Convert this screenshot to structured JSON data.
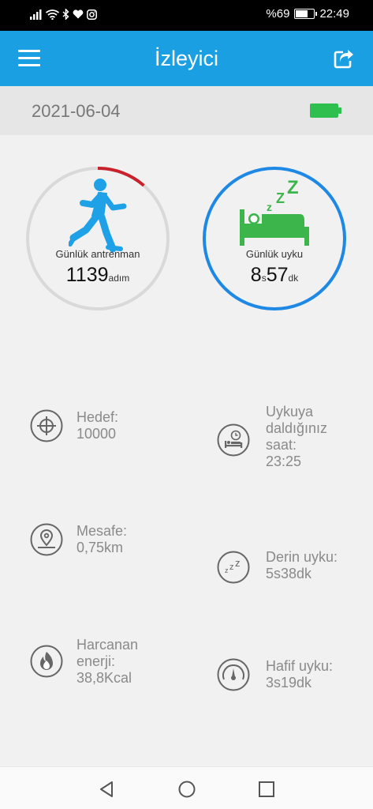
{
  "status_bar": {
    "battery_text": "%69",
    "time": "22:49",
    "battery_level": 0.69,
    "icons": [
      "signal-icon",
      "wifi-icon",
      "bluetooth-icon",
      "heart-icon",
      "instagram-icon",
      "battery-icon"
    ]
  },
  "app_bar": {
    "title": "İzleyici",
    "menu_icon": "menu-icon",
    "share_icon": "share-icon",
    "color": "#1aa0e2"
  },
  "date_bar": {
    "date": "2021-06-04",
    "device_battery_icon": "battery-full-icon",
    "device_battery_color": "#2fbf4e"
  },
  "activity_ring": {
    "label": "Günlük antrenman",
    "steps": "1139",
    "unit": "adım",
    "progress": 0.1139,
    "progress_color": "#c8232c",
    "track_color": "#d9d9d9",
    "icon": "running-person-icon"
  },
  "sleep_ring": {
    "label": "Günlük uyku",
    "hours": "8",
    "hours_unit": "s",
    "minutes": "57",
    "minutes_unit": "dk",
    "ring_color": "#1e88e5",
    "icon": "sleeping-bed-icon",
    "icon_color": "#3cb54a"
  },
  "stats_left": [
    {
      "icon": "target-icon",
      "text": "Hedef:\n10000"
    },
    {
      "icon": "location-pin-icon",
      "text": "Mesafe:\n0,75km"
    },
    {
      "icon": "flame-icon",
      "text": "Harcanan\nenerji:\n38,8Kcal"
    }
  ],
  "stats_right": [
    {
      "icon": "bed-clock-icon",
      "text": "Uykuya\ndaldığınız\nsaat:\n23:25"
    },
    {
      "icon": "zzz-icon",
      "text": "Derin uyku:\n5s38dk"
    },
    {
      "icon": "gauge-icon",
      "text": "Hafif uyku:\n3s19dk"
    }
  ],
  "nav_bar": {
    "back_icon": "back-icon",
    "home_icon": "home-icon",
    "recents_icon": "recents-icon"
  }
}
